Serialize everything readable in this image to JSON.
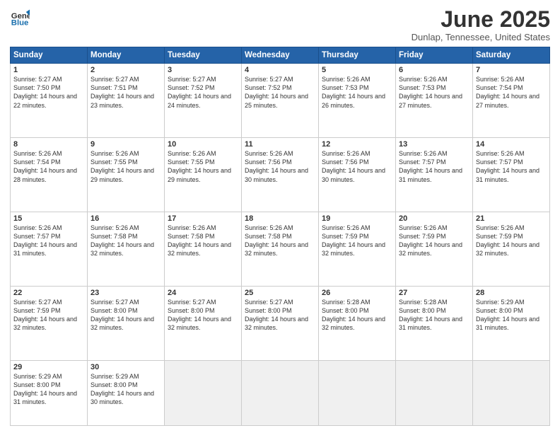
{
  "logo": {
    "general": "General",
    "blue": "Blue"
  },
  "title": {
    "month": "June 2025",
    "location": "Dunlap, Tennessee, United States"
  },
  "weekdays": [
    "Sunday",
    "Monday",
    "Tuesday",
    "Wednesday",
    "Thursday",
    "Friday",
    "Saturday"
  ],
  "weeks": [
    [
      {
        "day": "1",
        "sunrise": "5:27 AM",
        "sunset": "7:50 PM",
        "daylight": "14 hours and 22 minutes."
      },
      {
        "day": "2",
        "sunrise": "5:27 AM",
        "sunset": "7:51 PM",
        "daylight": "14 hours and 23 minutes."
      },
      {
        "day": "3",
        "sunrise": "5:27 AM",
        "sunset": "7:52 PM",
        "daylight": "14 hours and 24 minutes."
      },
      {
        "day": "4",
        "sunrise": "5:27 AM",
        "sunset": "7:52 PM",
        "daylight": "14 hours and 25 minutes."
      },
      {
        "day": "5",
        "sunrise": "5:26 AM",
        "sunset": "7:53 PM",
        "daylight": "14 hours and 26 minutes."
      },
      {
        "day": "6",
        "sunrise": "5:26 AM",
        "sunset": "7:53 PM",
        "daylight": "14 hours and 27 minutes."
      },
      {
        "day": "7",
        "sunrise": "5:26 AM",
        "sunset": "7:54 PM",
        "daylight": "14 hours and 27 minutes."
      }
    ],
    [
      {
        "day": "8",
        "sunrise": "5:26 AM",
        "sunset": "7:54 PM",
        "daylight": "14 hours and 28 minutes."
      },
      {
        "day": "9",
        "sunrise": "5:26 AM",
        "sunset": "7:55 PM",
        "daylight": "14 hours and 29 minutes."
      },
      {
        "day": "10",
        "sunrise": "5:26 AM",
        "sunset": "7:55 PM",
        "daylight": "14 hours and 29 minutes."
      },
      {
        "day": "11",
        "sunrise": "5:26 AM",
        "sunset": "7:56 PM",
        "daylight": "14 hours and 30 minutes."
      },
      {
        "day": "12",
        "sunrise": "5:26 AM",
        "sunset": "7:56 PM",
        "daylight": "14 hours and 30 minutes."
      },
      {
        "day": "13",
        "sunrise": "5:26 AM",
        "sunset": "7:57 PM",
        "daylight": "14 hours and 31 minutes."
      },
      {
        "day": "14",
        "sunrise": "5:26 AM",
        "sunset": "7:57 PM",
        "daylight": "14 hours and 31 minutes."
      }
    ],
    [
      {
        "day": "15",
        "sunrise": "5:26 AM",
        "sunset": "7:57 PM",
        "daylight": "14 hours and 31 minutes."
      },
      {
        "day": "16",
        "sunrise": "5:26 AM",
        "sunset": "7:58 PM",
        "daylight": "14 hours and 32 minutes."
      },
      {
        "day": "17",
        "sunrise": "5:26 AM",
        "sunset": "7:58 PM",
        "daylight": "14 hours and 32 minutes."
      },
      {
        "day": "18",
        "sunrise": "5:26 AM",
        "sunset": "7:58 PM",
        "daylight": "14 hours and 32 minutes."
      },
      {
        "day": "19",
        "sunrise": "5:26 AM",
        "sunset": "7:59 PM",
        "daylight": "14 hours and 32 minutes."
      },
      {
        "day": "20",
        "sunrise": "5:26 AM",
        "sunset": "7:59 PM",
        "daylight": "14 hours and 32 minutes."
      },
      {
        "day": "21",
        "sunrise": "5:26 AM",
        "sunset": "7:59 PM",
        "daylight": "14 hours and 32 minutes."
      }
    ],
    [
      {
        "day": "22",
        "sunrise": "5:27 AM",
        "sunset": "7:59 PM",
        "daylight": "14 hours and 32 minutes."
      },
      {
        "day": "23",
        "sunrise": "5:27 AM",
        "sunset": "8:00 PM",
        "daylight": "14 hours and 32 minutes."
      },
      {
        "day": "24",
        "sunrise": "5:27 AM",
        "sunset": "8:00 PM",
        "daylight": "14 hours and 32 minutes."
      },
      {
        "day": "25",
        "sunrise": "5:27 AM",
        "sunset": "8:00 PM",
        "daylight": "14 hours and 32 minutes."
      },
      {
        "day": "26",
        "sunrise": "5:28 AM",
        "sunset": "8:00 PM",
        "daylight": "14 hours and 32 minutes."
      },
      {
        "day": "27",
        "sunrise": "5:28 AM",
        "sunset": "8:00 PM",
        "daylight": "14 hours and 31 minutes."
      },
      {
        "day": "28",
        "sunrise": "5:29 AM",
        "sunset": "8:00 PM",
        "daylight": "14 hours and 31 minutes."
      }
    ],
    [
      {
        "day": "29",
        "sunrise": "5:29 AM",
        "sunset": "8:00 PM",
        "daylight": "14 hours and 31 minutes."
      },
      {
        "day": "30",
        "sunrise": "5:29 AM",
        "sunset": "8:00 PM",
        "daylight": "14 hours and 30 minutes."
      },
      null,
      null,
      null,
      null,
      null
    ]
  ]
}
